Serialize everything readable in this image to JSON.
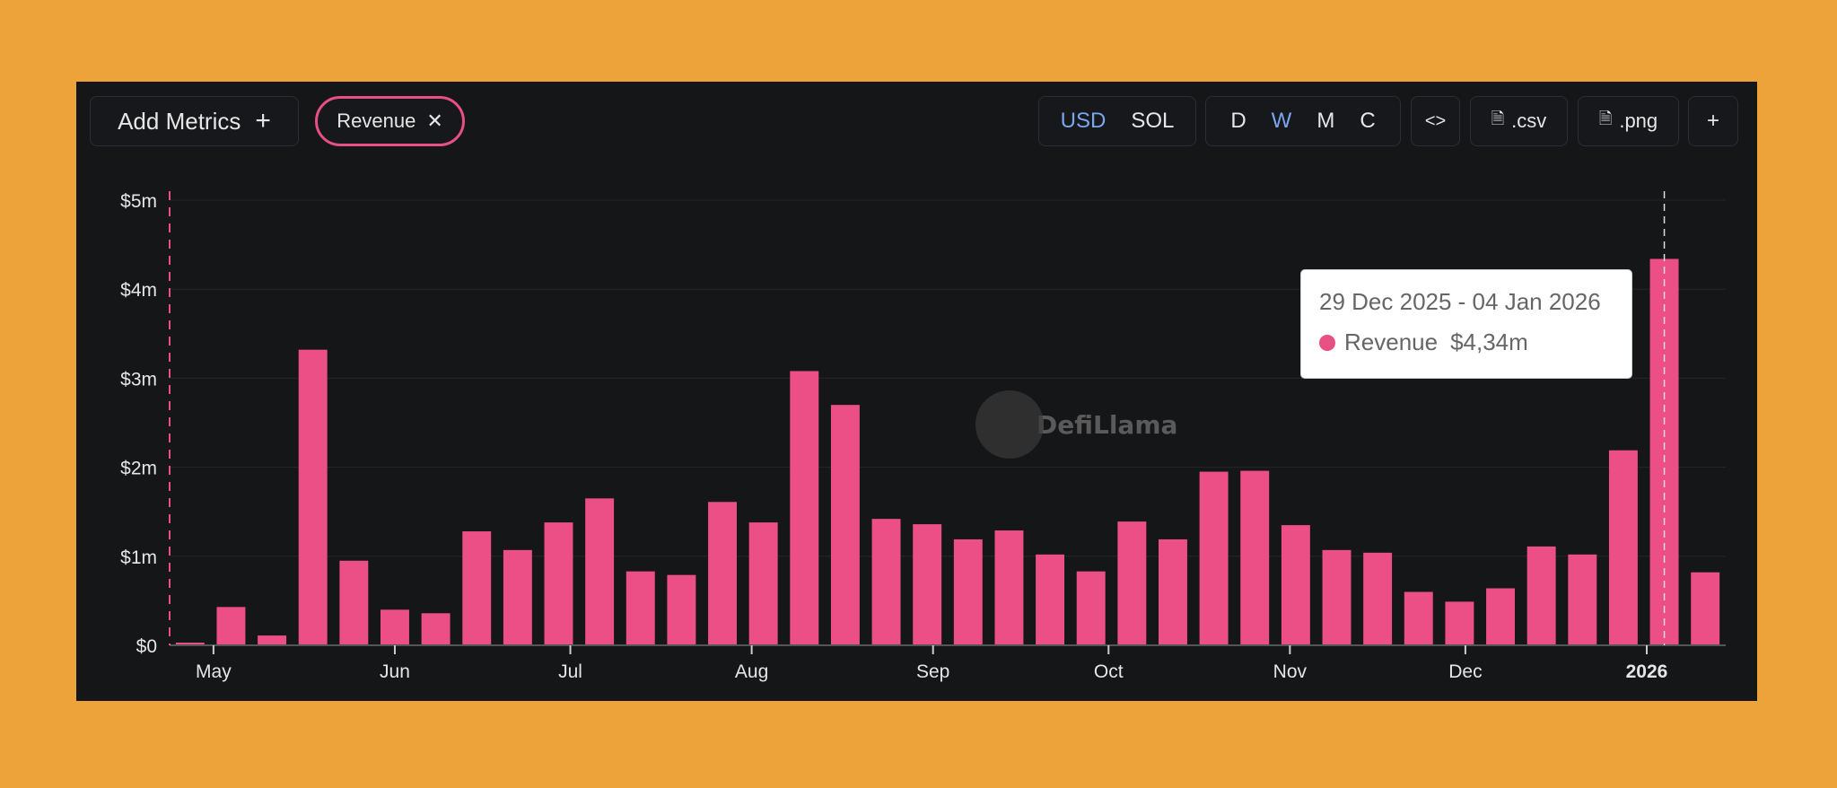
{
  "toolbar": {
    "add_metrics": "Add Metrics",
    "add_icon": "+",
    "metric_pill": "Revenue",
    "close_icon": "✕",
    "currency": [
      "USD",
      "SOL"
    ],
    "currency_active": "USD",
    "periods": [
      "D",
      "W",
      "M",
      "C"
    ],
    "period_active": "W",
    "embed": "<>",
    "csv": ".csv",
    "png": ".png",
    "plus": "+"
  },
  "watermark": "DefiLlama",
  "tooltip": {
    "date": "29 Dec 2025 - 04 Jan 2026",
    "series": "Revenue",
    "value": "$4,34m"
  },
  "colors": {
    "bar": "#EC4F85",
    "accent": "#7AA6EE",
    "background": "#151618",
    "frame": "#EEA23A"
  },
  "chart_data": {
    "type": "bar",
    "title": "",
    "xlabel": "",
    "ylabel": "",
    "series": [
      {
        "name": "Revenue",
        "color": "#EC4F85",
        "values": [
          0.03,
          0.43,
          0.11,
          3.32,
          0.95,
          0.4,
          0.36,
          1.28,
          1.07,
          1.38,
          1.65,
          0.83,
          0.79,
          1.61,
          1.38,
          3.08,
          2.7,
          1.42,
          1.36,
          1.19,
          1.29,
          1.02,
          0.83,
          1.39,
          1.19,
          1.95,
          1.96,
          1.35,
          1.07,
          1.04,
          0.6,
          0.49,
          0.64,
          1.11,
          1.02,
          2.19,
          4.34,
          0.82
        ]
      }
    ],
    "first_week_start": "2025-04-21",
    "interval": "weekly",
    "unit": "USD millions",
    "ylim": [
      0,
      5
    ],
    "yticks": [
      {
        "v": 0,
        "label": "$0"
      },
      {
        "v": 1,
        "label": "$1m"
      },
      {
        "v": 2,
        "label": "$2m"
      },
      {
        "v": 3,
        "label": "$3m"
      },
      {
        "v": 4,
        "label": "$4m"
      },
      {
        "v": 5,
        "label": "$5m"
      }
    ],
    "xticks": [
      {
        "date": "2025-05-01",
        "label": "May"
      },
      {
        "date": "2025-06-01",
        "label": "Jun"
      },
      {
        "date": "2025-07-01",
        "label": "Jul"
      },
      {
        "date": "2025-08-01",
        "label": "Aug"
      },
      {
        "date": "2025-09-01",
        "label": "Sep"
      },
      {
        "date": "2025-10-01",
        "label": "Oct"
      },
      {
        "date": "2025-11-01",
        "label": "Nov"
      },
      {
        "date": "2025-12-01",
        "label": "Dec"
      },
      {
        "date": "2026-01-01",
        "label": "2026",
        "bold": true
      }
    ],
    "highlighted_index": 36,
    "grid": true,
    "legend": "none"
  }
}
